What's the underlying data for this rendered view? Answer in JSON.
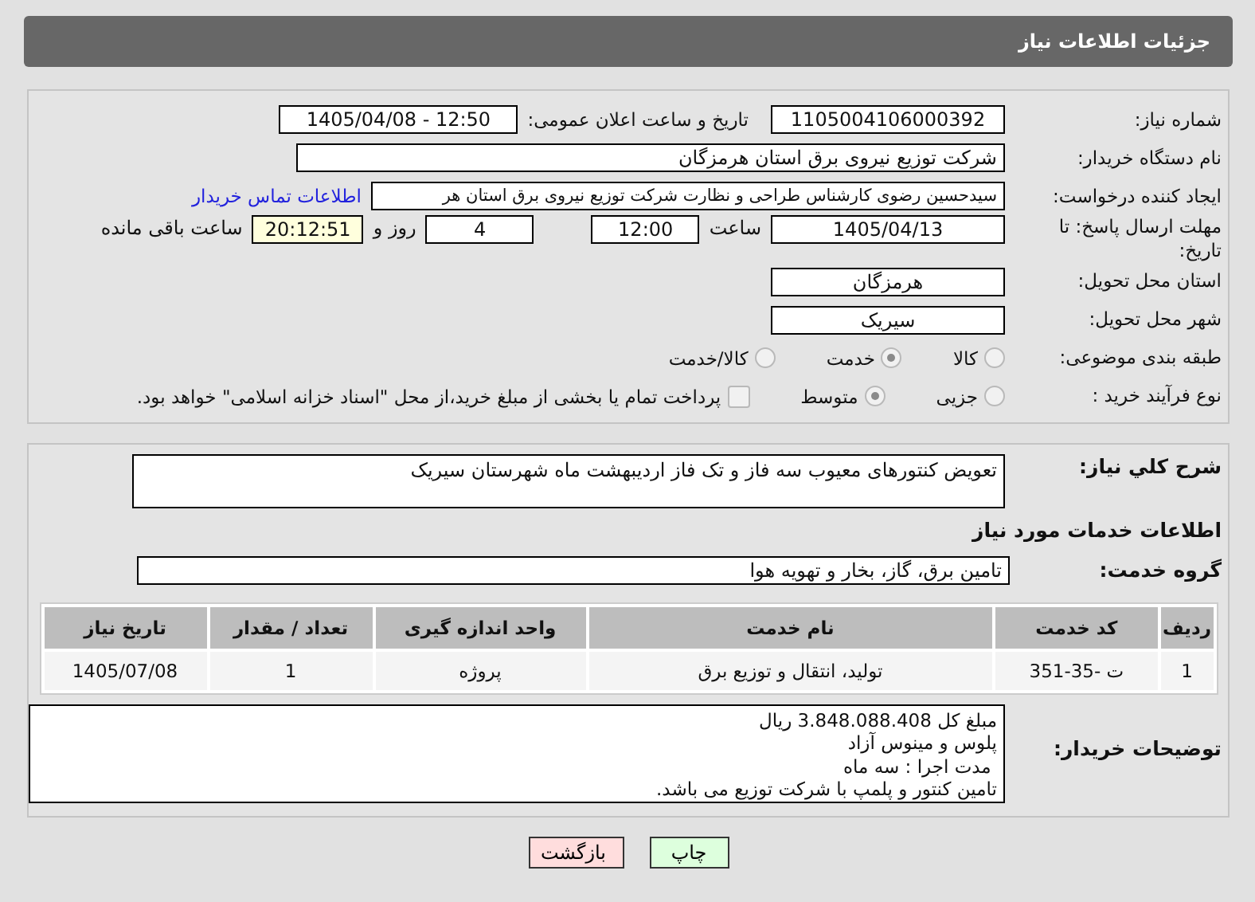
{
  "header": {
    "title": "جزئیات اطلاعات نیاز"
  },
  "details": {
    "need_number": {
      "label": "شماره نیاز:",
      "value": "1105004106000392"
    },
    "announce": {
      "label": "تاریخ و ساعت اعلان عمومی:",
      "value": "1405/04/08 - 12:50"
    },
    "buyer_org": {
      "label": "نام دستگاه خریدار:",
      "value": "شرکت توزیع نیروی برق استان هرمزگان"
    },
    "requester": {
      "label": "ایجاد کننده درخواست:",
      "value": "سیدحسین رضوی کارشناس طراحی و نظارت شرکت توزیع نیروی برق استان هر",
      "link": "اطلاعات تماس خریدار"
    },
    "deadline": {
      "label": "مهلت ارسال پاسخ: تا تاریخ:",
      "date": "1405/04/13",
      "time_label": "ساعت",
      "time": "12:00",
      "days": "4",
      "days_label": "روز و",
      "remaining": "20:12:51",
      "remaining_label": "ساعت باقی مانده"
    },
    "province": {
      "label": "استان محل تحویل:",
      "value": "هرمزگان"
    },
    "city": {
      "label": "شهر محل تحویل:",
      "value": "سیریک"
    },
    "category": {
      "label": "طبقه بندی موضوعی:",
      "options": [
        {
          "label": "کالا",
          "selected": false
        },
        {
          "label": "خدمت",
          "selected": true
        },
        {
          "label": "کالا/خدمت",
          "selected": false
        }
      ]
    },
    "process": {
      "label": "نوع فرآیند خرید :",
      "options": [
        {
          "label": "جزیی",
          "selected": false
        },
        {
          "label": "متوسط",
          "selected": true
        }
      ],
      "payment": {
        "checked": false,
        "label": "پرداخت تمام یا بخشی از مبلغ خرید،از محل \"اسناد خزانه اسلامی\" خواهد بود."
      }
    }
  },
  "summary": {
    "label": "شرح كلي نياز:",
    "value": "تعویض کنتورهای معیوب سه فاز و تک فاز اردیبهشت ماه شهرستان سیریک"
  },
  "services": {
    "heading": "اطلاعات خدمات مورد نياز",
    "group_label": "گروه خدمت:",
    "group": "تامین برق، گاز، بخار و تهویه هوا",
    "table": {
      "columns": [
        "ردیف",
        "کد خدمت",
        "نام خدمت",
        "واحد اندازه گیری",
        "تعداد / مقدار",
        "تاریخ نیاز"
      ],
      "rows": [
        [
          "1",
          "ت -35-351",
          "تولید، انتقال و توزیع برق",
          "پروژه",
          "1",
          "1405/07/08"
        ]
      ]
    }
  },
  "notes": {
    "label": "توضیحات خریدار:",
    "lines": [
      "مبلغ کل 3.848.088.408 ریال",
      "پلوس و مینوس آزاد",
      " مدت اجرا : سه ماه",
      "تامین کنتور و پلمپ با شرکت توزیع می باشد."
    ]
  },
  "buttons": {
    "print": "چاپ",
    "back": "بازگشت"
  }
}
